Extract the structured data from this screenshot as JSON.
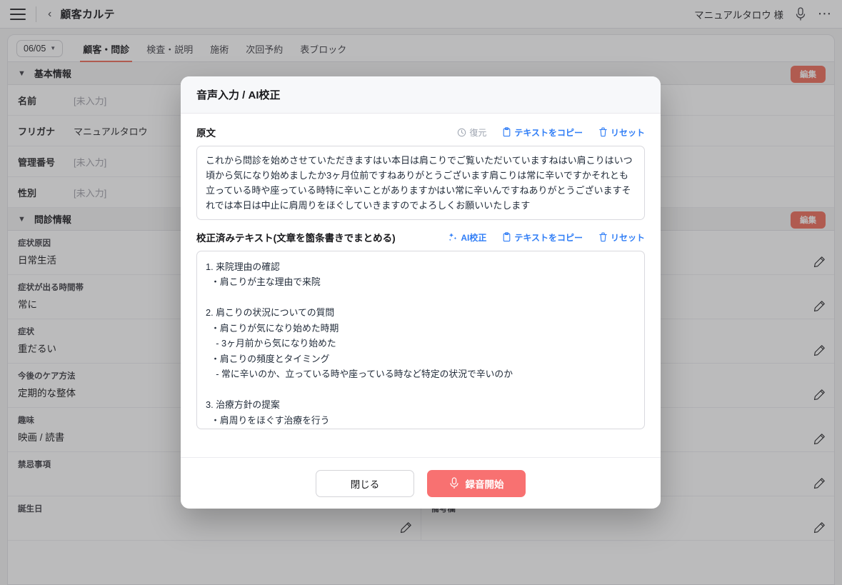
{
  "topbar": {
    "menu_icon": "hamburger-icon",
    "back_icon": "chevron-left-icon",
    "title": "顧客カルテ",
    "username": "マニュアルタロウ 様",
    "mic_icon": "microphone-icon",
    "more_icon": "ellipsis-icon"
  },
  "tabs": {
    "date_label": "06/05",
    "items": [
      {
        "label": "顧客・問診",
        "active": true
      },
      {
        "label": "検査・説明",
        "active": false
      },
      {
        "label": "施術",
        "active": false
      },
      {
        "label": "次回予約",
        "active": false
      },
      {
        "label": "表ブロック",
        "active": false
      }
    ]
  },
  "sections": [
    {
      "title": "基本情報",
      "edit_label": "編集",
      "rows": [
        {
          "key": "名前",
          "value": "[未入力]",
          "empty": true
        },
        {
          "key": "フリガナ",
          "value": "マニュアルタロウ",
          "empty": false
        },
        {
          "key": "管理番号",
          "value": "[未入力]",
          "empty": true
        },
        {
          "key": "性別",
          "value": "[未入力]",
          "empty": true
        }
      ]
    },
    {
      "title": "問診情報",
      "edit_label": "編集",
      "fields_left": [
        {
          "label": "症状原因",
          "value": "日常生活"
        },
        {
          "label": "症状が出る時間帯",
          "value": "常に"
        },
        {
          "label": "症状",
          "value": "重だるい"
        },
        {
          "label": "今後のケア方法",
          "value": "定期的な整体"
        },
        {
          "label": "趣味",
          "value": "映画 / 読書"
        },
        {
          "label": "禁忌事項",
          "value": ""
        },
        {
          "label": "誕生日",
          "value": ""
        }
      ],
      "fields_right": [
        {
          "label": "",
          "value": ""
        },
        {
          "label": "",
          "value": ""
        },
        {
          "label": "",
          "value": ""
        },
        {
          "label": "",
          "value": ""
        },
        {
          "label": "",
          "value": ""
        },
        {
          "label": "",
          "value": ""
        },
        {
          "label": "備考欄",
          "value": ""
        }
      ]
    }
  ],
  "modal": {
    "title": "音声入力 / AI校正",
    "original": {
      "label": "原文",
      "restore_label": "復元",
      "copy_label": "テキストをコピー",
      "reset_label": "リセット",
      "text": "これから問診を始めさせていただきますはい本日は肩こりでご覧いただいていますねはい肩こりはいつ頃から気になり始めましたか3ヶ月位前ですねありがとうございます肩こりは常に辛いですかそれとも立っている時や座っている時特に辛いことがありますかはい常に辛いんですねありがとうございますそれでは本日は中止に肩周りをほぐしていきますのでよろしくお願いいたします"
    },
    "corrected": {
      "label": "校正済みテキスト(文章を箇条書きでまとめる)",
      "ai_label": "AI校正",
      "copy_label": "テキストをコピー",
      "reset_label": "リセット",
      "text": "1. 来院理由の確認\n  ・肩こりが主な理由で来院\n\n2. 肩こりの状況についての質問\n  ・肩こりが気になり始めた時期\n    - 3ヶ月前から気になり始めた\n  ・肩こりの頻度とタイミング\n    - 常に辛いのか、立っている時や座っている時など特定の状況で辛いのか\n\n3. 治療方針の提案\n  ・肩周りをほぐす治療を行う"
    },
    "footer": {
      "close_label": "閉じる",
      "record_label": "録音開始",
      "record_icon": "microphone-icon"
    }
  },
  "colors": {
    "accent_red": "#ef6c5a",
    "record_red": "#f87171",
    "link_blue": "#2f7df6",
    "disabled_gray": "#9ca3af"
  }
}
